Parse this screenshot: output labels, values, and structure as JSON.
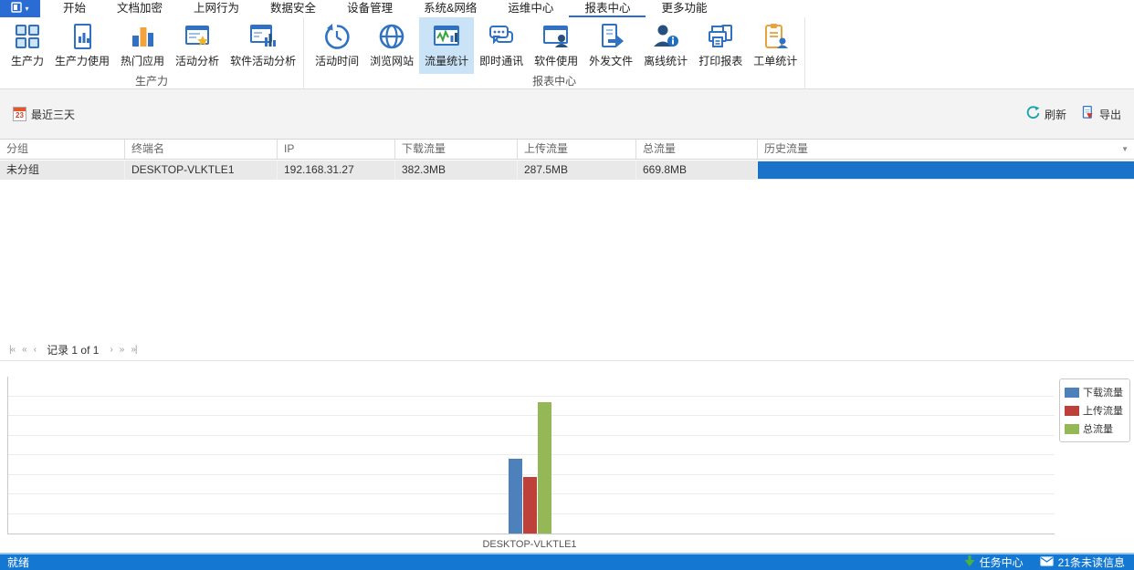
{
  "menu": {
    "tabs": [
      "开始",
      "文档加密",
      "上网行为",
      "数据安全",
      "设备管理",
      "系统&网络",
      "运维中心",
      "报表中心",
      "更多功能"
    ],
    "selected_tab": "报表中心",
    "app_button_icon": "app-window-icon"
  },
  "ribbon": {
    "groups": [
      {
        "label": "生产力",
        "buttons": [
          {
            "label": "生产力",
            "icon": "grid-icon"
          },
          {
            "label": "生产力使用",
            "icon": "document-chart-icon"
          },
          {
            "label": "热门应用",
            "icon": "bar-chart-icon"
          },
          {
            "label": "活动分析",
            "icon": "document-star-icon"
          },
          {
            "label": "软件活动分析",
            "icon": "window-chart-icon"
          }
        ]
      },
      {
        "label": "报表中心",
        "buttons": [
          {
            "label": "活动时间",
            "icon": "history-clock-icon"
          },
          {
            "label": "浏览网站",
            "icon": "globe-icon"
          },
          {
            "label": "流量统计",
            "icon": "traffic-chart-icon",
            "selected": true
          },
          {
            "label": "即时通讯",
            "icon": "chat-icon"
          },
          {
            "label": "软件使用",
            "icon": "window-user-icon"
          },
          {
            "label": "外发文件",
            "icon": "file-export-icon"
          },
          {
            "label": "离线统计",
            "icon": "user-info-icon"
          },
          {
            "label": "打印报表",
            "icon": "printer-icon"
          },
          {
            "label": "工单统计",
            "icon": "clipboard-user-icon"
          }
        ]
      }
    ]
  },
  "filter_bar": {
    "date_range_label": "最近三天",
    "calendar_day": "23",
    "refresh_label": "刷新",
    "export_label": "导出"
  },
  "table": {
    "columns": [
      "分组",
      "终端名",
      "IP",
      "下载流量",
      "上传流量",
      "总流量",
      "历史流量"
    ],
    "rows": [
      {
        "group": "未分组",
        "terminal": "DESKTOP-VLKTLE1",
        "ip": "192.168.31.27",
        "download": "382.3MB",
        "upload": "287.5MB",
        "total": "669.8MB",
        "history_bar_full": true
      }
    ]
  },
  "pager": {
    "label": "记录 1 of 1"
  },
  "chart_data": {
    "type": "bar",
    "categories": [
      "DESKTOP-VLKTLE1"
    ],
    "series": [
      {
        "name": "下载流量",
        "values": [
          382.3
        ],
        "color": "#4c81bc"
      },
      {
        "name": "上传流量",
        "values": [
          287.5
        ],
        "color": "#bd403a"
      },
      {
        "name": "总流量",
        "values": [
          669.8
        ],
        "color": "#93b855"
      }
    ],
    "unit": "MB",
    "ylim": [
      0,
      800
    ],
    "grid_step": 100,
    "grid": true,
    "legend_position": "right",
    "title": "",
    "xlabel": "",
    "ylabel": ""
  },
  "status_bar": {
    "ready_label": "就绪",
    "task_center_label": "任务中心",
    "unread_label": "21条未读信息"
  },
  "colors": {
    "accent_blue": "#2a6cd4",
    "ribbon_selected_bg": "#cbe3f6",
    "history_bar": "#1b73c9",
    "status_bar_bg": "#1478d2",
    "refresh_teal": "#16a3a9"
  }
}
